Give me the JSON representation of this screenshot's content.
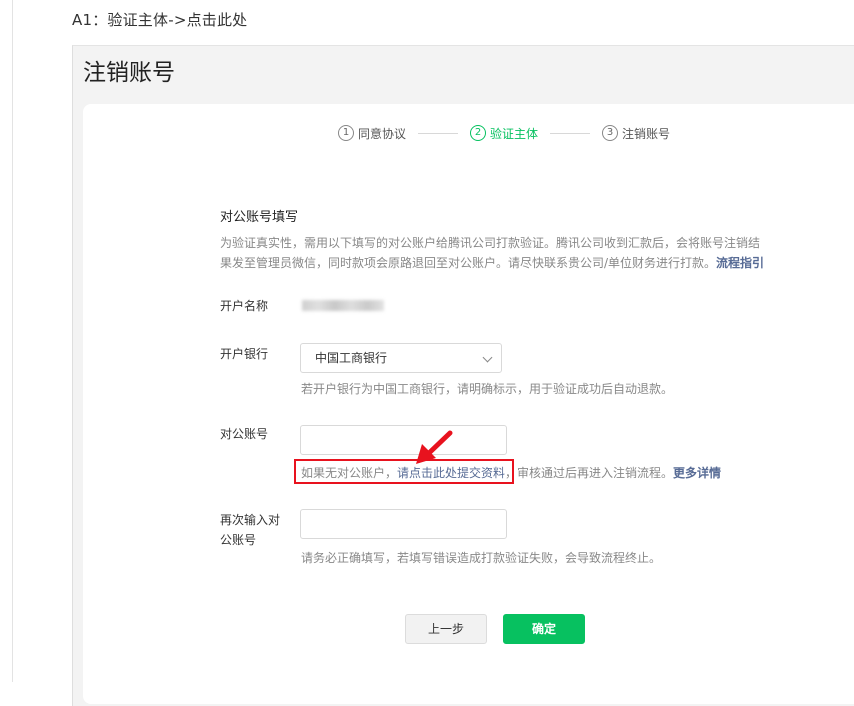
{
  "caption": "A1：验证主体->点击此处",
  "page_title": "注销账号",
  "steps": [
    {
      "num": "1",
      "label": "同意协议",
      "active": false
    },
    {
      "num": "2",
      "label": "验证主体",
      "active": true
    },
    {
      "num": "3",
      "label": "注销账号",
      "active": false
    }
  ],
  "section": {
    "title": "对公账号填写",
    "desc_line1": "为验证真实性，需用以下填写的对公账户给腾讯公司打款验证。腾讯公司收到汇款后，会将账号注销结",
    "desc_line2": "果发至管理员微信，同时款项会原路退回至对公账户。请尽快联系贵公司/单位财务进行打款。",
    "desc_link": "流程指引"
  },
  "form": {
    "account_name_label": "开户名称",
    "bank_label": "开户银行",
    "bank_value": "中国工商银行",
    "bank_hint": "若开户银行为中国工商银行，请明确标示，用于验证成功后自动退款。",
    "account_label": "对公账号",
    "account_value": "",
    "account_hint_pre": "如果无对公账户，",
    "account_hint_link": "请点击此处提交资料",
    "account_hint_mid": "，审核通过后再进入注销流程。",
    "account_hint_more": "更多详情",
    "confirm_label_line1": "再次输入对",
    "confirm_label_line2": "公账号",
    "confirm_value": "",
    "confirm_hint": "请务必正确填写，若填写错误造成打款验证失败，会导致流程终止。"
  },
  "buttons": {
    "prev": "上一步",
    "ok": "确定"
  },
  "colors": {
    "accent": "#07c160",
    "link": "#576b95",
    "annotation": "#e8121e"
  }
}
